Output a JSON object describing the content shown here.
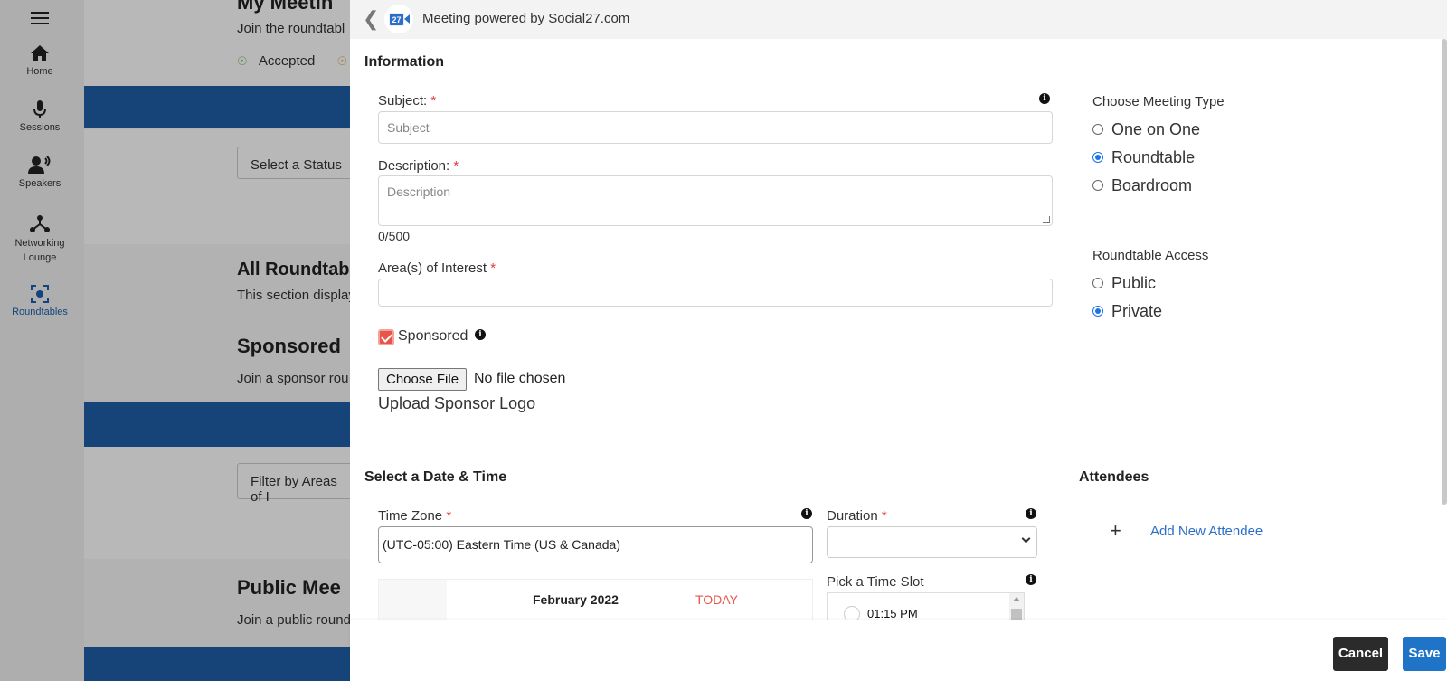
{
  "nav": {
    "items": [
      {
        "label": "Home",
        "icon": "home-icon"
      },
      {
        "label": "Sessions",
        "icon": "microphone-icon"
      },
      {
        "label": "Speakers",
        "icon": "speaker-icon"
      },
      {
        "label": "Networking Lounge",
        "icon": "network-icon"
      },
      {
        "label": "Roundtables",
        "icon": "roundtable-icon",
        "active": true
      }
    ]
  },
  "background": {
    "my_meetings_title": "My Meetin",
    "my_meetings_sub": "Join the roundtabl",
    "accepted": "Accepted",
    "select_status": "Select a Status",
    "all_roundtables_title": "All Roundtab",
    "all_roundtables_sub": "This section display",
    "sponsored_title": "Sponsored",
    "sponsored_sub": "Join a sponsor rou",
    "filter": "Filter by Areas of I",
    "public_title": "Public Mee",
    "public_sub": "Join a public round"
  },
  "modal": {
    "header_title": "Meeting powered by Social27.com",
    "logo_text": "27",
    "information": "Information",
    "subject_label": "Subject:",
    "subject_placeholder": "Subject",
    "description_label": "Description:",
    "description_placeholder": "Description",
    "counter": "0/500",
    "areas_label": "Area(s) of Interest",
    "required_mark": "*",
    "sponsored_label": "Sponsored",
    "sponsored_checked": true,
    "choose_file": "Choose File",
    "no_file": "No file chosen",
    "upload_logo": "Upload Sponsor Logo",
    "meeting_type_label": "Choose Meeting Type",
    "meeting_types": [
      "One on One",
      "Roundtable",
      "Boardroom"
    ],
    "meeting_type_selected": "Roundtable",
    "access_label": "Roundtable Access",
    "access_options": [
      "Public",
      "Private"
    ],
    "access_selected": "Private",
    "date_time_section": "Select a Date & Time",
    "timezone_label": "Time Zone",
    "timezone_value": "(UTC-05:00) Eastern Time (US & Canada)",
    "duration_label": "Duration",
    "duration_value": "",
    "month": "February 2022",
    "today": "TODAY",
    "pick_slot_label": "Pick a Time Slot",
    "slot": "01:15 PM",
    "attendees_section": "Attendees",
    "plus": "+",
    "add_attendee": "Add New Attendee",
    "cancel": "Cancel",
    "save": "Save"
  },
  "colors": {
    "accent": "#1f74c8",
    "band": "#1f5fa8",
    "required": "#e03a3a",
    "checkbox": "#e8534a"
  }
}
